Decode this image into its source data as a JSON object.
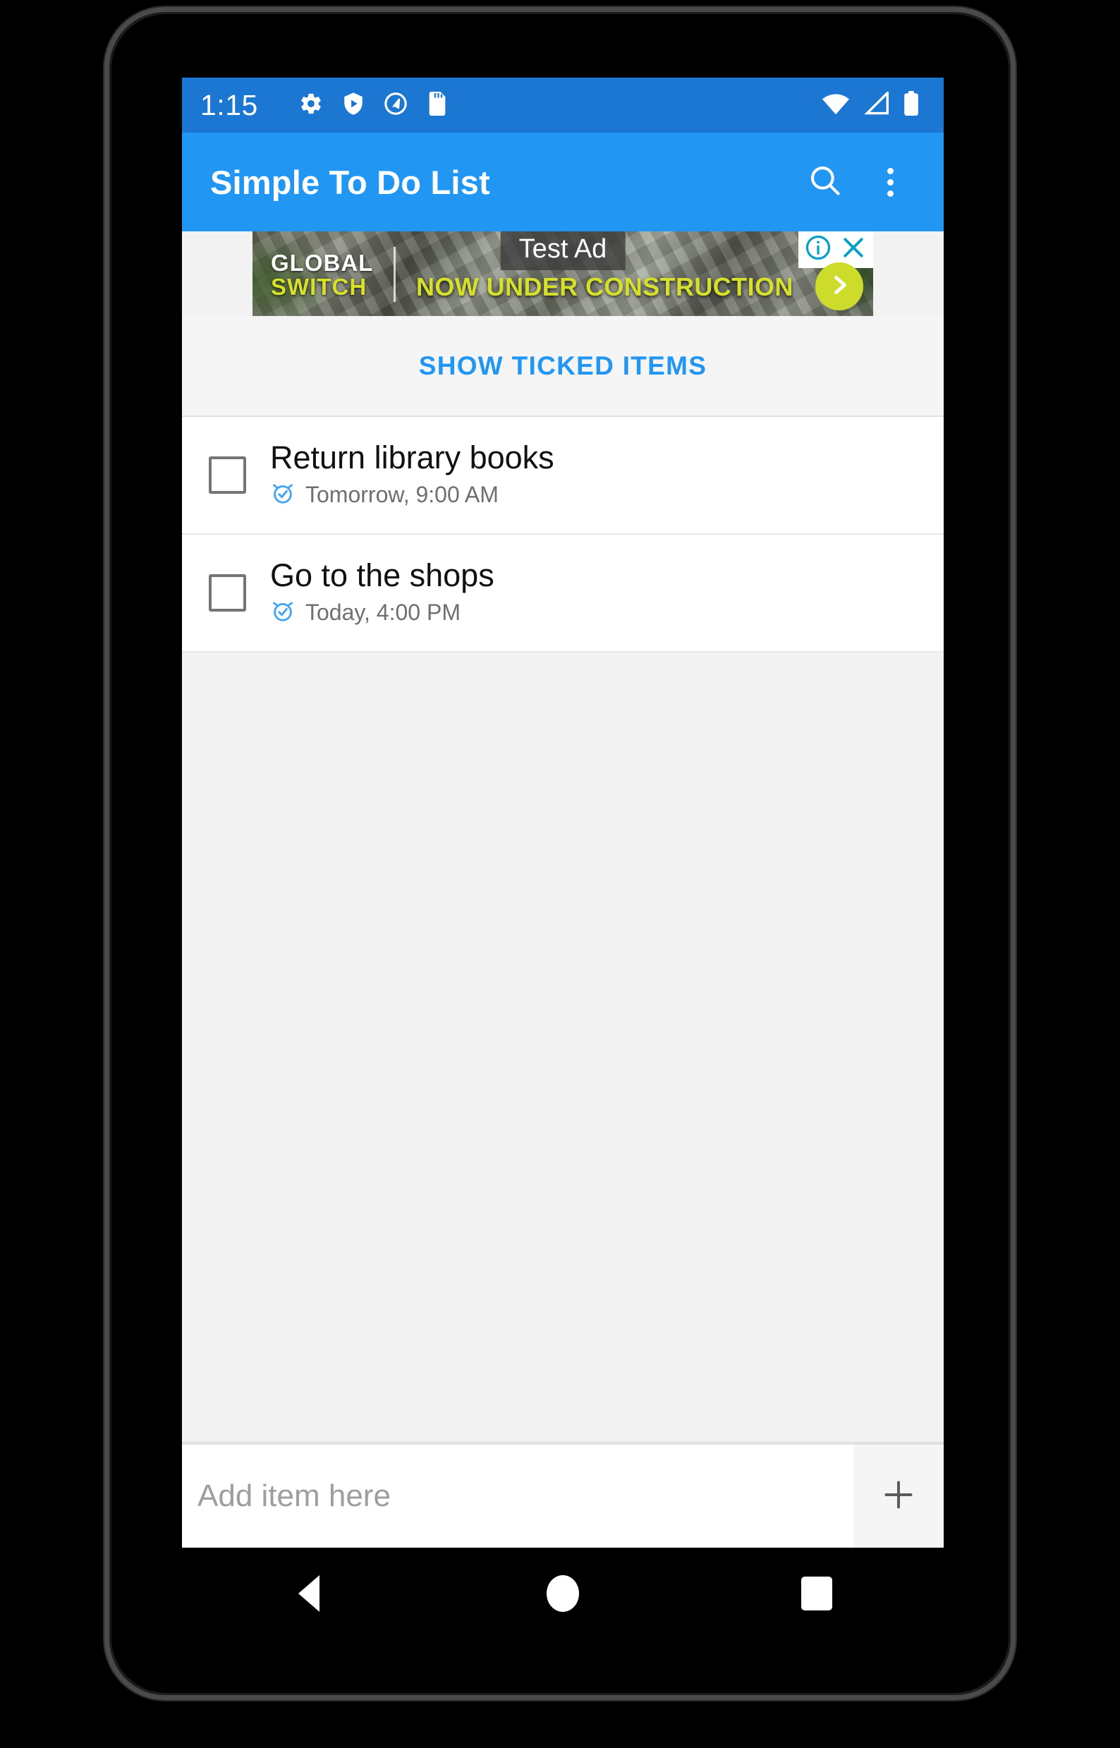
{
  "status_bar": {
    "clock": "1:15",
    "left_icons": [
      "gear-icon",
      "shield-play-icon",
      "quick-circle-icon",
      "sd-card-icon"
    ],
    "right_icons": [
      "wifi-icon",
      "cell-signal-icon",
      "battery-icon"
    ],
    "background_color": "#1b77d1"
  },
  "app_bar": {
    "title": "Simple To Do List",
    "search_icon": "search-icon",
    "overflow_icon": "overflow-menu-icon",
    "background_color": "#2196f3"
  },
  "ad": {
    "label": "Test Ad",
    "brand_line_1": "GLOBAL",
    "brand_line_2": "SWITCH",
    "headline": "NOW UNDER CONSTRUCTION",
    "info_icon": "ad-info-icon",
    "close_icon": "ad-close-icon",
    "cta_icon": "chevron-right-icon",
    "accent_color": "#d6e02a",
    "cta_color": "#cddc2a",
    "badge_color": "#00a0c6"
  },
  "toolbar": {
    "show_ticked_label": "SHOW TICKED ITEMS",
    "accent_color": "#2196f3"
  },
  "todos": [
    {
      "title": "Return library books",
      "due": "Tomorrow, 9:00 AM",
      "checked": false,
      "alarm_icon": "alarm-check-icon"
    },
    {
      "title": "Go to the shops",
      "due": "Today, 4:00 PM",
      "checked": false,
      "alarm_icon": "alarm-check-icon"
    }
  ],
  "add_bar": {
    "placeholder": "Add item here",
    "value": "",
    "add_icon": "plus-icon"
  },
  "nav_bar": {
    "back_label": "Back",
    "home_label": "Home",
    "recents_label": "Recents"
  }
}
